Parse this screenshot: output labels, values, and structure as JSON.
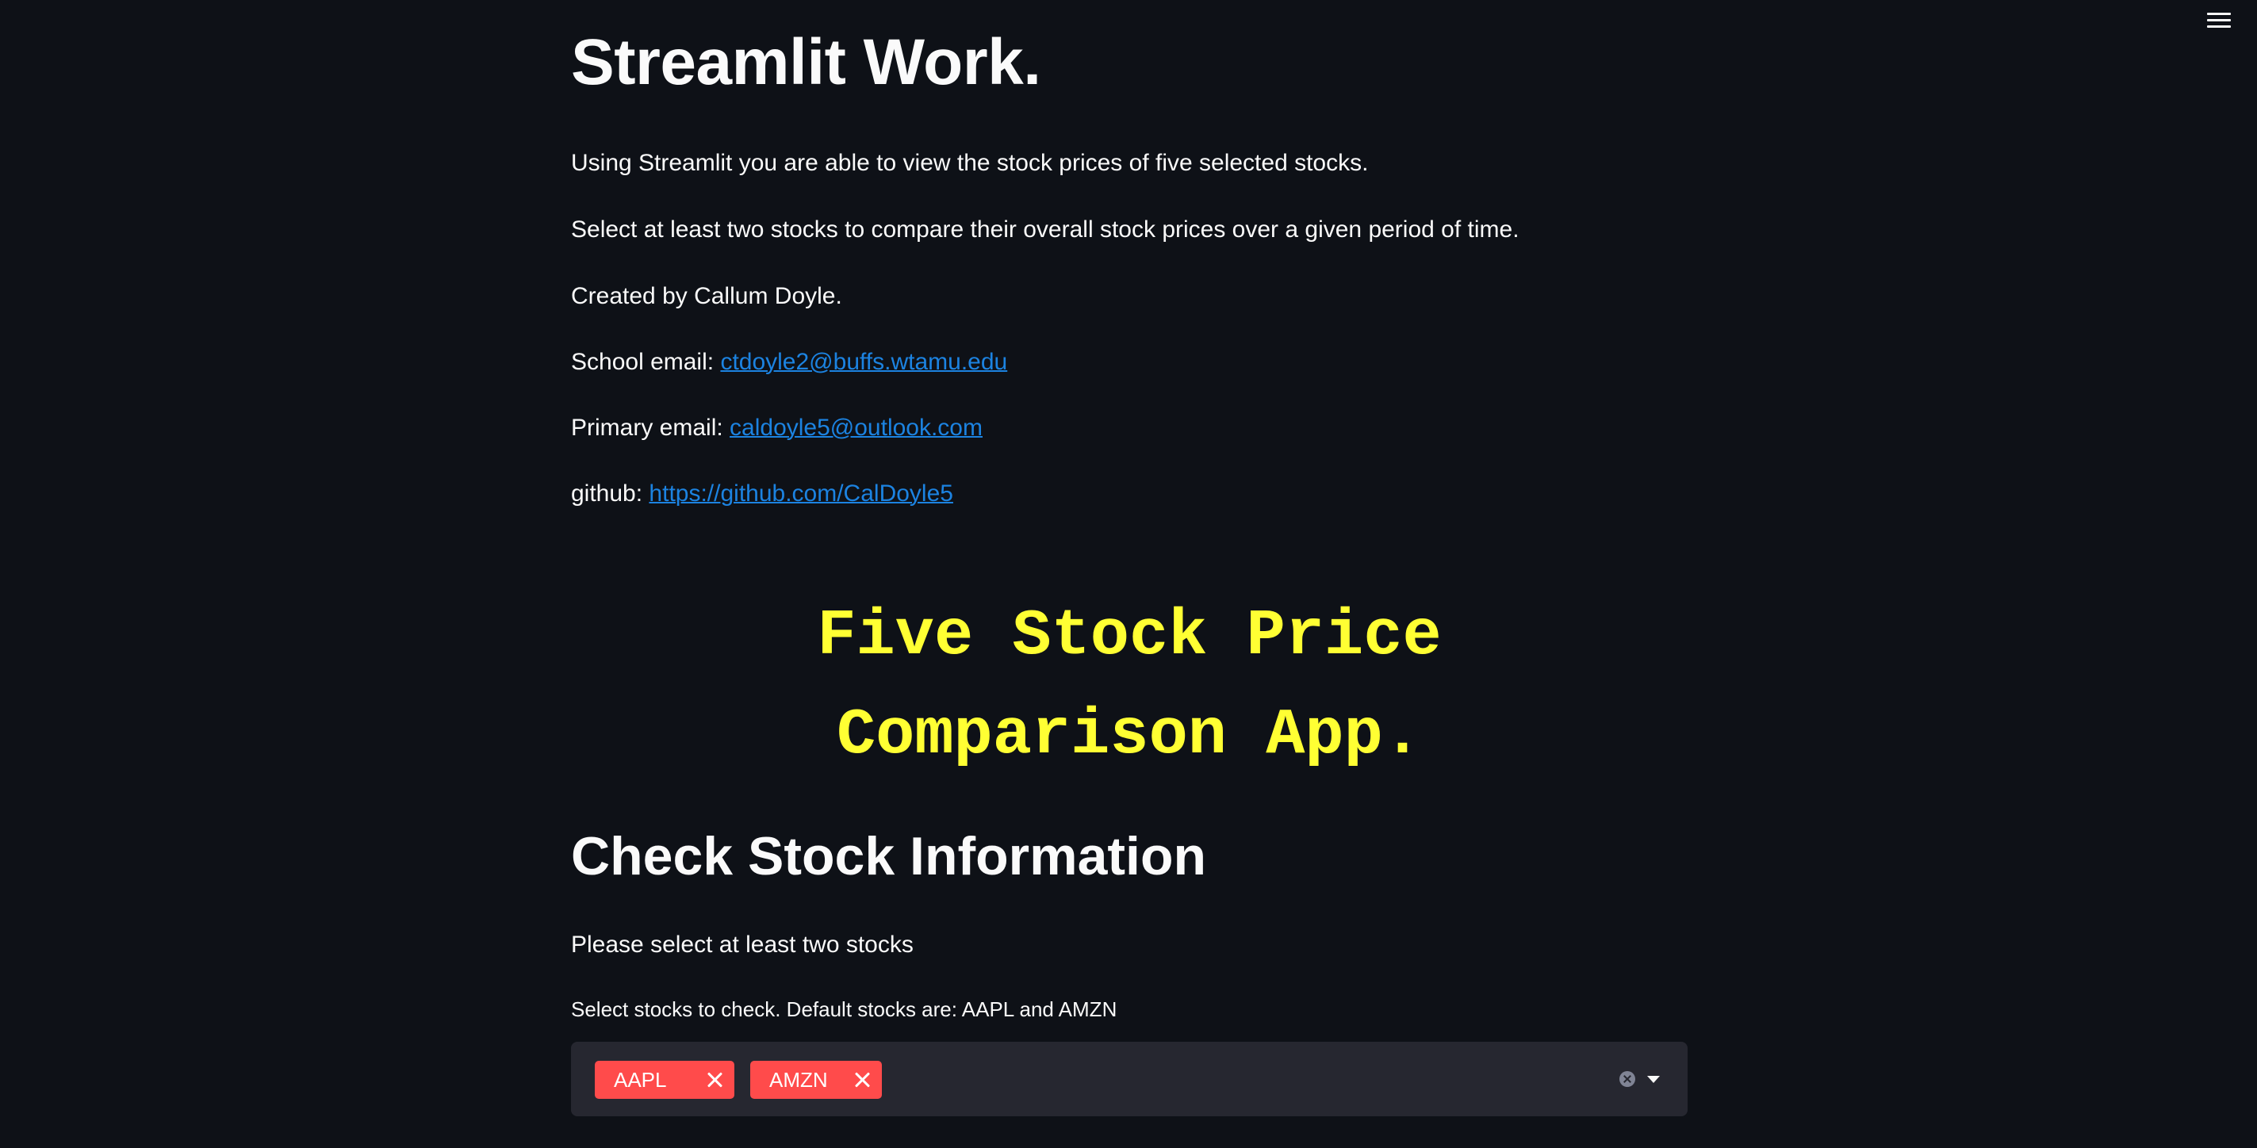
{
  "app": {
    "title": "Streamlit Work.",
    "menu_icon": "hamburger-menu-icon"
  },
  "intro": {
    "description": "Using Streamlit you are able to view the stock prices of five selected stocks.",
    "instruction": "Select at least two stocks to compare their overall stock prices over a given period of time.",
    "created_by": "Created by Callum Doyle.",
    "school_email_label": "School email: ",
    "school_email": "ctdoyle2@buffs.wtamu.edu",
    "primary_email_label": "Primary email: ",
    "primary_email": "caldoyle5@outlook.com",
    "github_label": "github: ",
    "github_url": "https://github.com/CalDoyle5"
  },
  "banner": {
    "line1": "Five Stock Price",
    "line2": "Comparison App.",
    "color": "#ffff33"
  },
  "stock_section": {
    "title": "Check Stock Information",
    "prompt": "Please select at least two stocks",
    "select_label": "Select stocks to check. Default stocks are: AAPL and AMZN",
    "selected": [
      "AAPL",
      "AMZN"
    ]
  },
  "colors": {
    "background": "#0e1117",
    "link": "#1c83e1",
    "tag": "#ff4b4b",
    "input_background": "#262730"
  }
}
